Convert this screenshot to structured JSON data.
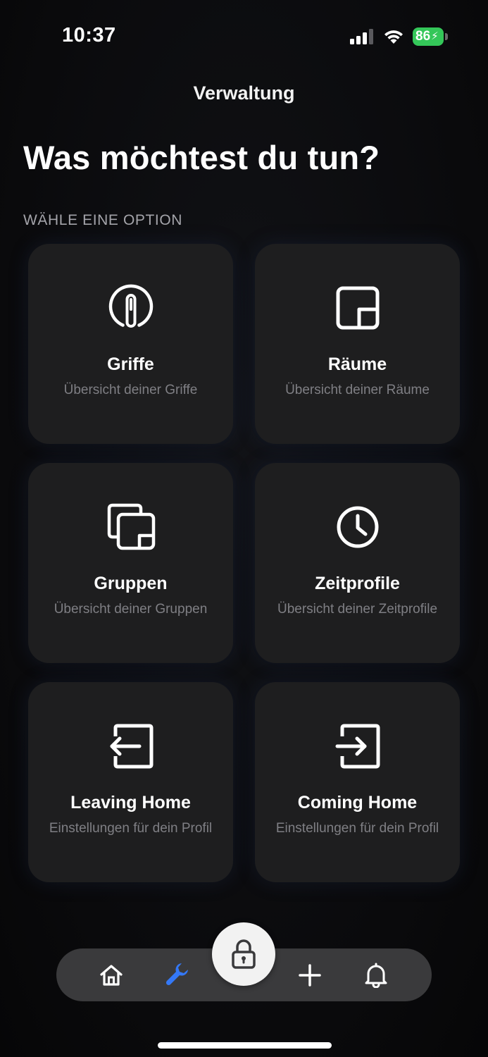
{
  "status_bar": {
    "time": "10:37",
    "battery_level": "86",
    "signal_icon": "cellular-signal-icon",
    "wifi_icon": "wifi-icon",
    "battery_color": "#34c759"
  },
  "header": {
    "title": "Verwaltung",
    "heading": "Was möchtest du tun?",
    "section_label": "WÄHLE EINE OPTION"
  },
  "options": [
    {
      "title": "Griffe",
      "subtitle": "Übersicht deiner Griffe",
      "icon": "handle-icon"
    },
    {
      "title": "Räume",
      "subtitle": "Übersicht deiner Räume",
      "icon": "room-icon"
    },
    {
      "title": "Gruppen",
      "subtitle": "Übersicht deiner Gruppen",
      "icon": "groups-icon"
    },
    {
      "title": "Zeitprofile",
      "subtitle": "Übersicht deiner Zeitprofile",
      "icon": "clock-icon"
    },
    {
      "title": "Leaving Home",
      "subtitle": "Einstellungen für dein Profil",
      "icon": "exit-icon"
    },
    {
      "title": "Coming Home",
      "subtitle": "Einstellungen für dein Profil",
      "icon": "enter-icon"
    }
  ],
  "tab_bar": {
    "items": [
      {
        "icon": "home-icon",
        "active": false
      },
      {
        "icon": "wrench-icon",
        "active": true
      },
      {
        "icon": "lock-icon",
        "active": false
      },
      {
        "icon": "plus-icon",
        "active": false
      },
      {
        "icon": "bell-icon",
        "active": false
      }
    ],
    "active_color": "#3478f6",
    "inactive_color": "#ffffff"
  }
}
